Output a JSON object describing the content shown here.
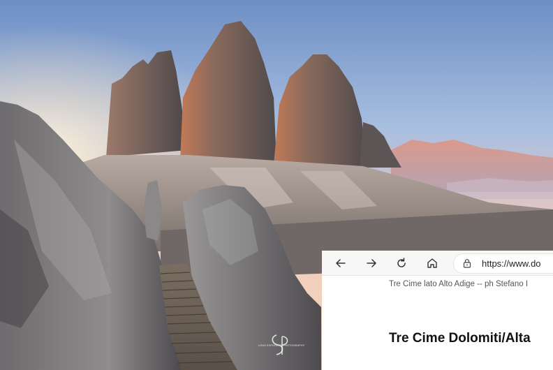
{
  "photo": {
    "watermark_text": "LONG EXPOSURE PHOTOGRAPHY"
  },
  "browser": {
    "back_icon": "arrow-left",
    "forward_icon": "arrow-right",
    "reload_icon": "reload",
    "home_icon": "home",
    "lock_icon": "lock",
    "url": "https://www.do",
    "caption": "Tre Cime lato Alto Adige -- ph Stefano I",
    "heading": "Tre Cime Dolomiti/Alta"
  }
}
